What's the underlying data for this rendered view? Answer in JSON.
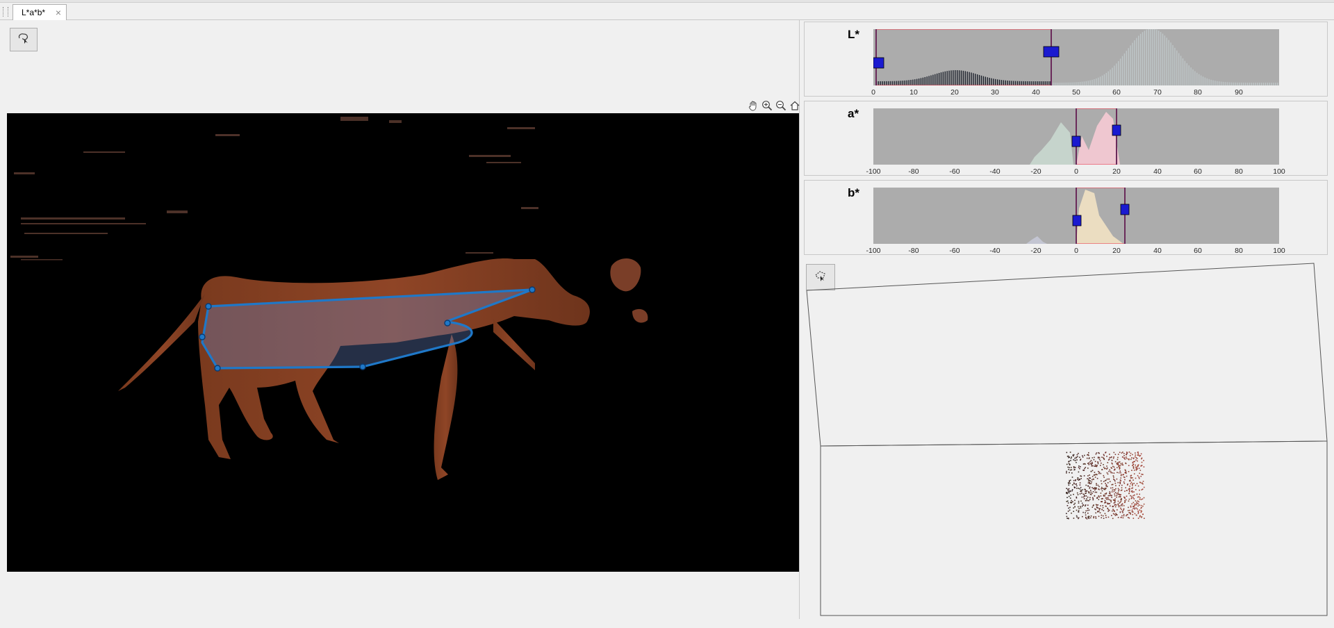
{
  "tab": {
    "label": "L*a*b*",
    "close_glyph": "×"
  },
  "icons": {
    "freehand_tool": "freehand-lasso-icon",
    "pan": "pan-hand-icon",
    "zoom_in": "zoom-in-icon",
    "zoom_out": "zoom-out-icon",
    "restore_view": "home-icon",
    "polygon_tool": "polygon-select-icon"
  },
  "colors": {
    "roi_stroke": "#1f78c8",
    "handle_fill": "#1a1ad0",
    "range_box": "#e8485a",
    "histogram_bg": "#acacac"
  },
  "histograms": [
    {
      "label": "L*",
      "ticks": [
        "0",
        "10",
        "20",
        "30",
        "40",
        "50",
        "60",
        "70",
        "80",
        "90"
      ],
      "range": [
        1.5,
        44
      ]
    },
    {
      "label": "a*",
      "ticks": [
        "-100",
        "-80",
        "-60",
        "-40",
        "-20",
        "0",
        "20",
        "40",
        "60",
        "80",
        "100"
      ],
      "range": [
        0,
        20
      ]
    },
    {
      "label": "b*",
      "ticks": [
        "-100",
        "-80",
        "-60",
        "-40",
        "-20",
        "0",
        "20",
        "40",
        "60",
        "80",
        "100"
      ],
      "range": [
        0,
        24
      ]
    }
  ],
  "status": {
    "text": ""
  }
}
